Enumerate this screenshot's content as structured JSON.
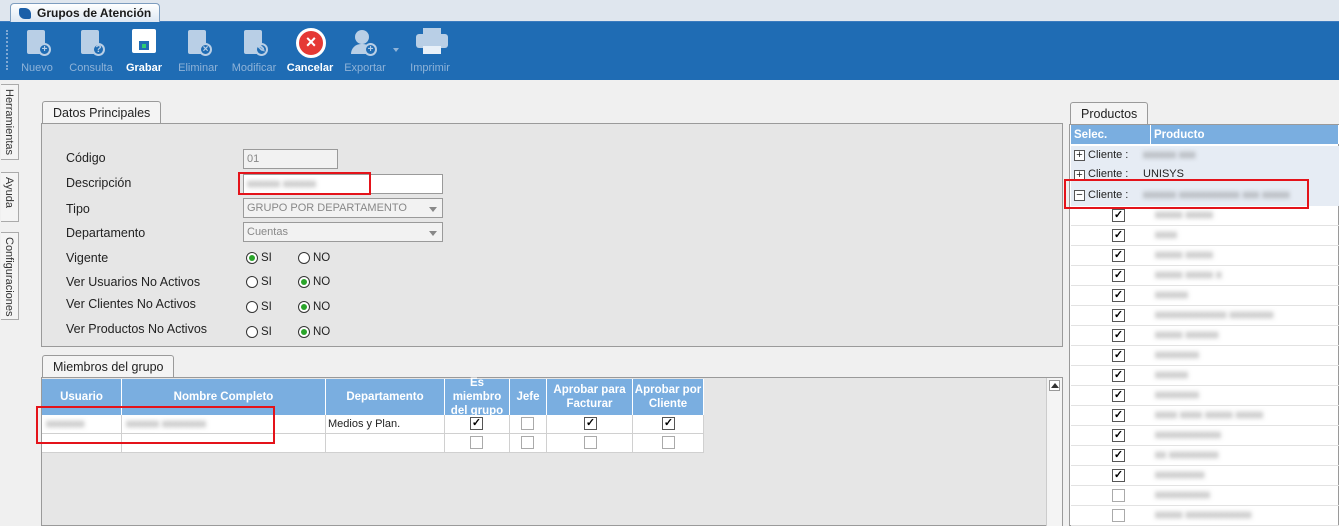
{
  "window_tab": {
    "title": "Grupos de Atención"
  },
  "toolbar": {
    "items": [
      {
        "label": "Nuevo",
        "icon": "new-document-icon",
        "enabled": false
      },
      {
        "label": "Consulta",
        "icon": "query-document-icon",
        "enabled": false
      },
      {
        "label": "Grabar",
        "icon": "save-floppy-icon",
        "enabled": true
      },
      {
        "label": "Eliminar",
        "icon": "delete-document-icon",
        "enabled": false
      },
      {
        "label": "Modificar",
        "icon": "edit-document-icon",
        "enabled": false
      },
      {
        "label": "Cancelar",
        "icon": "cancel-icon",
        "enabled": true
      },
      {
        "label": "Exportar",
        "icon": "export-user-icon",
        "enabled": false
      },
      {
        "label": "Imprimir",
        "icon": "printer-icon",
        "enabled": false
      }
    ]
  },
  "side_tabs": [
    "Herramientas",
    "Ayuda",
    "Configuraciones"
  ],
  "datos_principales": {
    "tab_label": "Datos Principales",
    "codigo": {
      "label": "Código",
      "value": "01"
    },
    "descripcion": {
      "label": "Descripción",
      "value": "xxxxxx xxxxxx"
    },
    "tipo": {
      "label": "Tipo",
      "value": "GRUPO POR DEPARTAMENTO"
    },
    "departamento": {
      "label": "Departamento",
      "value": "Cuentas"
    },
    "radios": [
      {
        "label": "Vigente",
        "si": "SI",
        "no": "NO",
        "selected": "si"
      },
      {
        "label": "Ver Usuarios No Activos",
        "si": "SI",
        "no": "NO",
        "selected": "no"
      },
      {
        "label": "Ver Clientes No Activos",
        "si": "SI",
        "no": "NO",
        "selected": "no"
      },
      {
        "label": "Ver Productos No Activos",
        "si": "SI",
        "no": "NO",
        "selected": "no"
      }
    ]
  },
  "miembros": {
    "tab_label": "Miembros del grupo",
    "columns": [
      "Usuario",
      "Nombre Completo",
      "Departamento",
      "Es miembro del grupo",
      "Jefe",
      "Aprobar para Facturar",
      "Aprobar por Cliente"
    ],
    "rows": [
      {
        "usuario": "xxxxxxx",
        "nombre": "xxxxxx xxxxxxxx",
        "departamento": "Medios y Plan.",
        "miembro": true,
        "jefe": false,
        "facturar": true,
        "cliente": true
      },
      {
        "usuario": "",
        "nombre": "",
        "departamento": "",
        "miembro": false,
        "jefe": false,
        "facturar": false,
        "cliente": false
      }
    ]
  },
  "productos": {
    "tab_label": "Productos",
    "columns": [
      "Selec.",
      "Producto"
    ],
    "clients": [
      {
        "expander": "+",
        "label": "Cliente :",
        "name": "xxxxxx xxx"
      },
      {
        "expander": "+",
        "label": "Cliente :",
        "name": "UNISYS"
      },
      {
        "expander": "−",
        "label": "Cliente :",
        "name": "xxxxxx xxxxxxxxxxx xxx xxxxx"
      }
    ],
    "items": [
      {
        "checked": true,
        "name": "xxxxx xxxxx"
      },
      {
        "checked": true,
        "name": "xxxx"
      },
      {
        "checked": true,
        "name": "xxxxx xxxxx"
      },
      {
        "checked": true,
        "name": "xxxxx xxxxx x"
      },
      {
        "checked": true,
        "name": "xxxxxx"
      },
      {
        "checked": true,
        "name": "xxxxxxxxxxxxx xxxxxxxx"
      },
      {
        "checked": true,
        "name": "xxxxx xxxxxx"
      },
      {
        "checked": true,
        "name": "xxxxxxxx"
      },
      {
        "checked": true,
        "name": "xxxxxx"
      },
      {
        "checked": true,
        "name": "xxxxxxxx"
      },
      {
        "checked": true,
        "name": "xxxx xxxx xxxxx xxxxx"
      },
      {
        "checked": true,
        "name": "xxxxxxxxxxxx"
      },
      {
        "checked": true,
        "name": "xx xxxxxxxxx"
      },
      {
        "checked": true,
        "name": "xxxxxxxxx"
      },
      {
        "checked": false,
        "name": "xxxxxxxxxx"
      },
      {
        "checked": false,
        "name": "xxxxx xxxxxxxxxxxx"
      }
    ]
  },
  "colors": {
    "toolbar": "#1f6cb4",
    "grid_header": "#7aaee0",
    "highlight": "#e4131a"
  }
}
